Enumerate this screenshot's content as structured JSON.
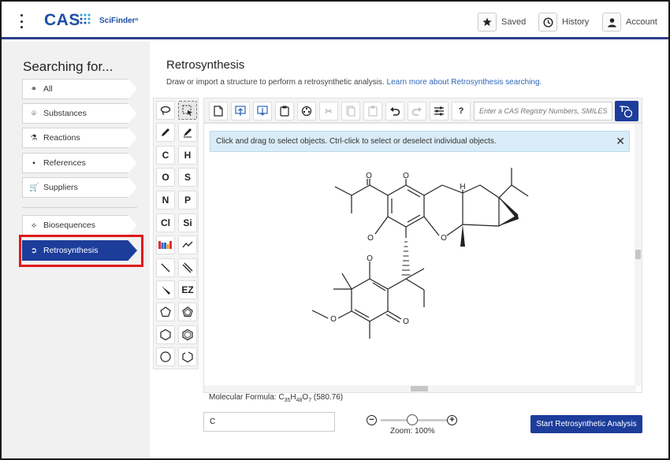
{
  "header": {
    "logo_text": "CAS",
    "product": "SciFinderⁿ",
    "saved_label": "Saved",
    "history_label": "History",
    "account_label": "Account"
  },
  "sidebar": {
    "title": "Searching for...",
    "items": [
      {
        "label": "All",
        "icon": "molecule-icon"
      },
      {
        "label": "Substances",
        "icon": "substance-icon"
      },
      {
        "label": "Reactions",
        "icon": "flask-icon"
      },
      {
        "label": "References",
        "icon": "document-icon"
      },
      {
        "label": "Suppliers",
        "icon": "cart-icon"
      },
      {
        "label": "Biosequences",
        "icon": "dna-icon"
      },
      {
        "label": "Retrosynthesis",
        "icon": "retrosynthesis-icon"
      }
    ],
    "active": "Retrosynthesis"
  },
  "main": {
    "title": "Retrosynthesis",
    "subtitle": "Draw or import a structure to perform a retrosynthetic analysis. ",
    "learn_more_link": "Learn more about Retrosynthesis searching."
  },
  "editor": {
    "input_placeholder": "Enter a CAS Registry Numbers, SMILES...",
    "info_message": "Click and drag to select objects. Ctrl-click to select or deselect individual objects.",
    "element_buttons": [
      "C",
      "H",
      "O",
      "S",
      "N",
      "P",
      "Cl",
      "Si"
    ],
    "ez_label": "EZ",
    "help_label": "?",
    "molecule_atom_labels": {
      "oxygen": "O",
      "hydrogen": "H"
    },
    "formula_prefix": "Molecular Formula: ",
    "formula_c": "C",
    "formula_c_count": "35",
    "formula_h": "H",
    "formula_h_count": "48",
    "formula_o": "O",
    "formula_o_count": "7",
    "formula_mass": " (580.76)",
    "bottom_input_value": "C"
  },
  "zoom": {
    "minus": "−",
    "plus": "+",
    "label": "Zoom: 100%"
  },
  "start_button_label": "Start Retrosynthetic Analysis",
  "colors": {
    "brand_blue": "#1d3d9b",
    "highlight_red": "#e01a1a",
    "info_bg": "#d9ecf7"
  }
}
